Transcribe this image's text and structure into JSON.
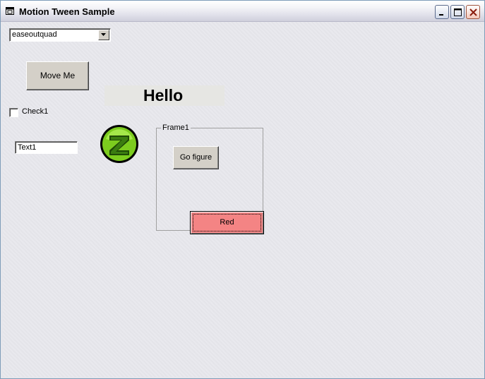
{
  "window": {
    "title": "Motion Tween Sample"
  },
  "controls": {
    "easing_combo": {
      "value": "easeoutquad"
    },
    "move_button": "Move Me",
    "hello_label": "Hello",
    "checkbox_label": "Check1",
    "checkbox_checked": false,
    "textbox_value": "Text1",
    "frame_caption": "Frame1",
    "go_figure_button": "Go figure",
    "red_button": "Red"
  },
  "colors": {
    "red_button_bg": "#f48484",
    "logo_green": "#7ccc1e"
  },
  "icons": [
    "app-window-icon",
    "minimize-icon",
    "maximize-icon",
    "close-icon",
    "dropdown-arrow-icon",
    "z-logo-icon"
  ]
}
